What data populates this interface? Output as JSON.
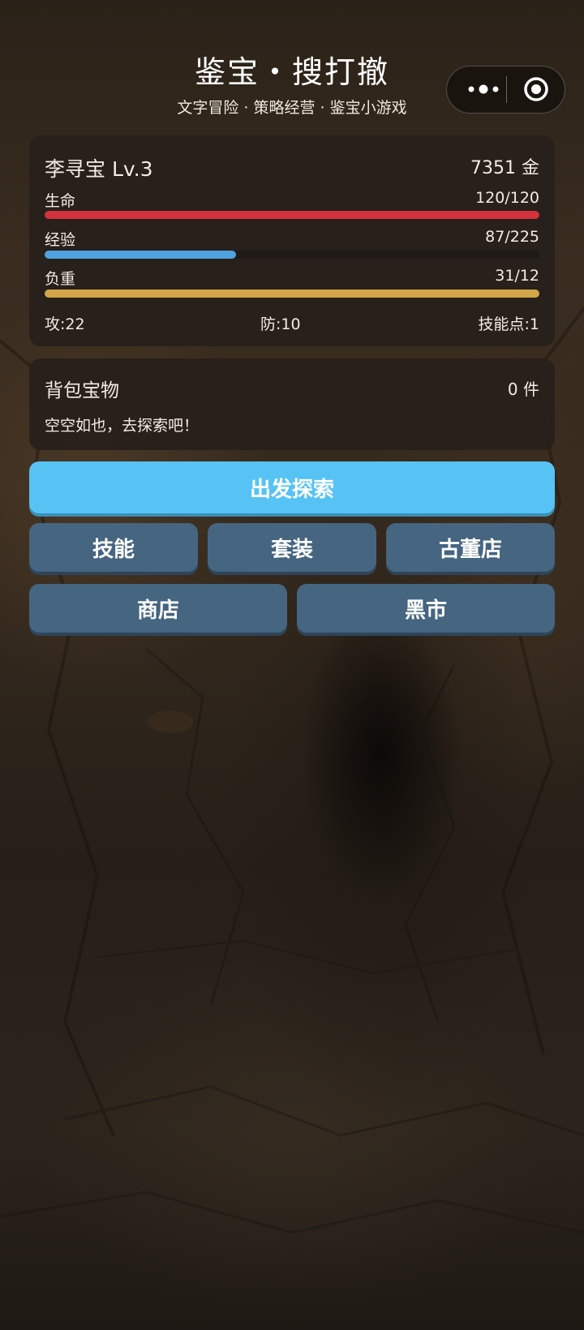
{
  "header": {
    "title": "鉴宝・搜打撤",
    "subtitle": "文字冒险 · 策略经营 · 鉴宝小游戏"
  },
  "capsule": {
    "more_icon": "more-dots-icon",
    "close_icon": "target-close-icon"
  },
  "player": {
    "name": "李寻宝 Lv.3",
    "gold": "7351 金",
    "stats": [
      {
        "label": "生命",
        "value": "120/120",
        "fraction": 1.0,
        "color": "#d3313b"
      },
      {
        "label": "经验",
        "value": "87/225",
        "fraction": 0.387,
        "color": "#4fa3e0"
      },
      {
        "label": "负重",
        "value": "31/12",
        "fraction": 1.0,
        "color": "#d2a548"
      }
    ],
    "attack": "攻:22",
    "defense": "防:10",
    "skill_points": "技能点:1"
  },
  "bag": {
    "title": "背包宝物",
    "count": "0 件",
    "empty_text": "空空如也，去探索吧！"
  },
  "buttons": {
    "explore": "出发探索",
    "skills": "技能",
    "sets": "套装",
    "antique_shop": "古董店",
    "shop": "商店",
    "black_market": "黑市"
  },
  "colors": {
    "primary_button": "#57c3f5",
    "secondary_button": "#456581",
    "card_bg": "#26201b"
  }
}
